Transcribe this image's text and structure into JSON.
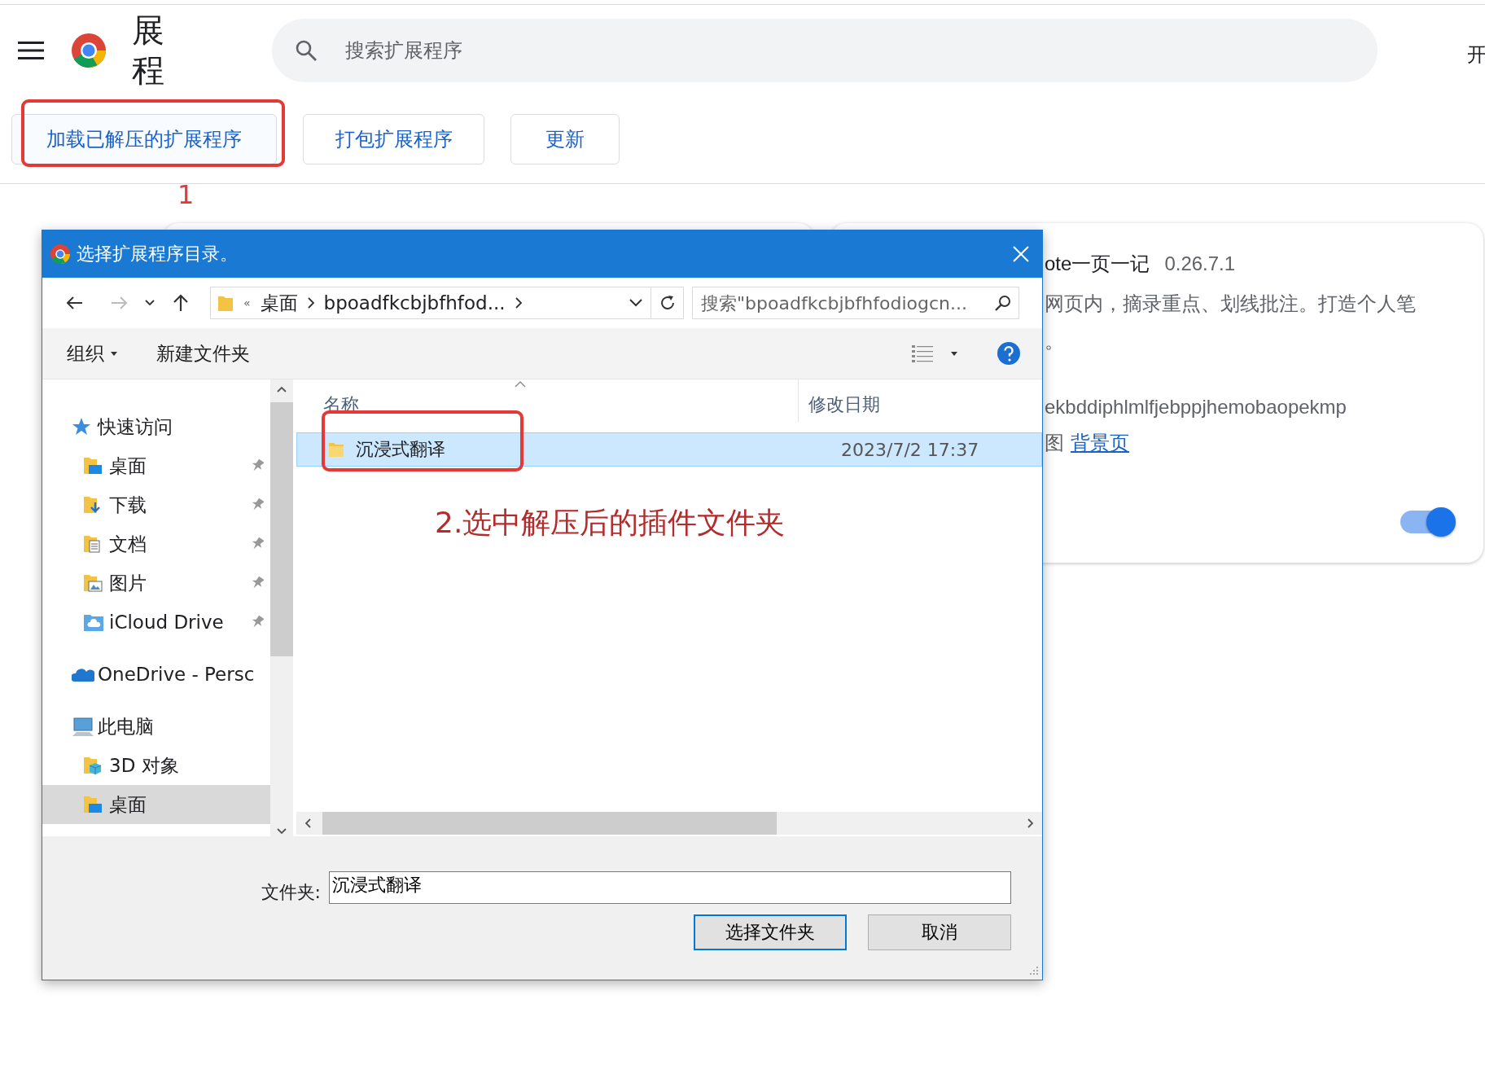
{
  "header": {
    "title": "展程",
    "search": {
      "placeholder": "搜索扩展程序"
    },
    "edge_text": "开"
  },
  "toolbar_buttons": [
    {
      "label": "加载已解压的扩展程序",
      "highlighted": true
    },
    {
      "label": "打包扩展程序",
      "highlighted": false
    },
    {
      "label": "更新",
      "highlighted": false
    }
  ],
  "annotations": [
    {
      "text": "1"
    },
    {
      "text": "2.选中解压后的插件文件夹"
    }
  ],
  "extension_card": {
    "name": "ote一页一记",
    "version": "0.26.7.1",
    "description_lines": [
      "网页内，摘录重点、划线批注。打造个人笔",
      "。"
    ],
    "id": "ekbddiphlmlfjebppjhemobaopekmp",
    "views_label": "图",
    "views_link": "背景页",
    "enabled": true
  },
  "dialog": {
    "title": "选择扩展程序目录。",
    "breadcrumb_overflow": "«",
    "breadcrumb": [
      "桌面",
      "bpoadfkcbjbfhfod..."
    ],
    "search": {
      "placeholder": "搜索\"bpoadfkcbjbfhfodiogcn..."
    },
    "commands": [
      {
        "label": "组织",
        "dropdown": true
      },
      {
        "label": "新建文件夹",
        "dropdown": false
      }
    ],
    "nav": [
      {
        "label": "快速访问",
        "kind": "star",
        "selected": false,
        "children": [
          {
            "label": "桌面",
            "kind": "desktop",
            "pinned": true,
            "selected": false
          },
          {
            "label": "下载",
            "kind": "download",
            "pinned": true,
            "selected": false
          },
          {
            "label": "文档",
            "kind": "document",
            "pinned": true,
            "selected": false
          },
          {
            "label": "图片",
            "kind": "pictures",
            "pinned": true,
            "selected": false
          },
          {
            "label": "iCloud Drive",
            "kind": "icloud",
            "pinned": true,
            "selected": false
          }
        ]
      },
      {
        "label": "OneDrive - Persc",
        "kind": "onedrive",
        "selected": false
      },
      {
        "label": "此电脑",
        "kind": "pc",
        "selected": false,
        "children": [
          {
            "label": "3D 对象",
            "kind": "objects3d",
            "pinned": false,
            "selected": false
          },
          {
            "label": "桌面",
            "kind": "desktop",
            "pinned": false,
            "selected": true
          }
        ]
      }
    ],
    "columns": [
      "名称",
      "修改日期"
    ],
    "rows": [
      {
        "name": "沉浸式翻译",
        "modified": "2023/7/2 17:37",
        "selected": true,
        "highlighted": true
      }
    ],
    "folder_label": "文件夹:",
    "folder_value": "沉浸式翻译",
    "buttons": [
      {
        "label": "选择文件夹",
        "kind": "primary"
      },
      {
        "label": "取消",
        "kind": "secondary"
      }
    ]
  }
}
